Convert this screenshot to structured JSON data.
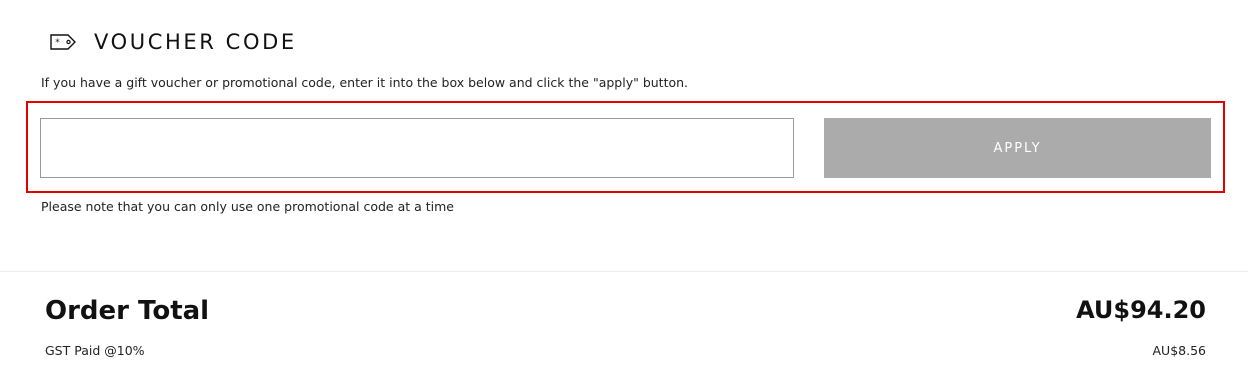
{
  "voucher": {
    "title": "VOUCHER CODE",
    "icon": "tag-icon",
    "instructions": "If you have a gift voucher or promotional code, enter it into the box below and click the \"apply\" button.",
    "input_value": "",
    "input_placeholder": "",
    "apply_label": "APPLY",
    "note": "Please note that you can only use one promotional code at a time"
  },
  "order": {
    "total_label": "Order Total",
    "total_value": "AU$94.20",
    "gst_label": "GST Paid @10%",
    "gst_value": "AU$8.56"
  },
  "colors": {
    "highlight": "#e60000",
    "apply_button_bg": "#ababab",
    "apply_button_text": "#ffffff",
    "input_border": "#9a9a9a"
  }
}
